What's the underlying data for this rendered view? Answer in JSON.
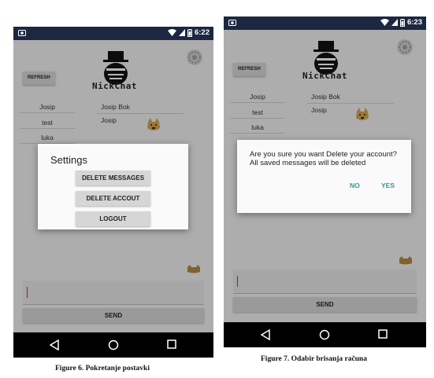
{
  "screens": [
    {
      "status_time": "6:22",
      "refresh_label": "REFRESH",
      "app_name": "NickChat",
      "contacts": [
        "Josip",
        "test",
        "luka"
      ],
      "messages": [
        "Josip  Bok",
        "Josip"
      ],
      "send_label": "SEND",
      "dialog": {
        "title": "Settings",
        "buttons": [
          "DELETE MESSAGES",
          "DELETE ACCOUT",
          "LOGOUT"
        ]
      },
      "caption": "Figure 6. Pokretanje postavki"
    },
    {
      "status_time": "6:23",
      "refresh_label": "REFRESH",
      "app_name": "NickChat",
      "contacts": [
        "Josip",
        "test",
        "luka"
      ],
      "messages": [
        "Josip  Bok",
        "Josip"
      ],
      "send_label": "SEND",
      "dialog": {
        "message": "Are you sure you want Delete your account? All saved messages will be deleted",
        "no_label": "NO",
        "yes_label": "YES"
      },
      "caption": "Figure 7. Odabir brisanja računa"
    }
  ],
  "colors": {
    "status_bar": "#1c2741",
    "nav_bar": "#000000",
    "accent": "#2a9d8f",
    "caret": "#d81b60"
  }
}
